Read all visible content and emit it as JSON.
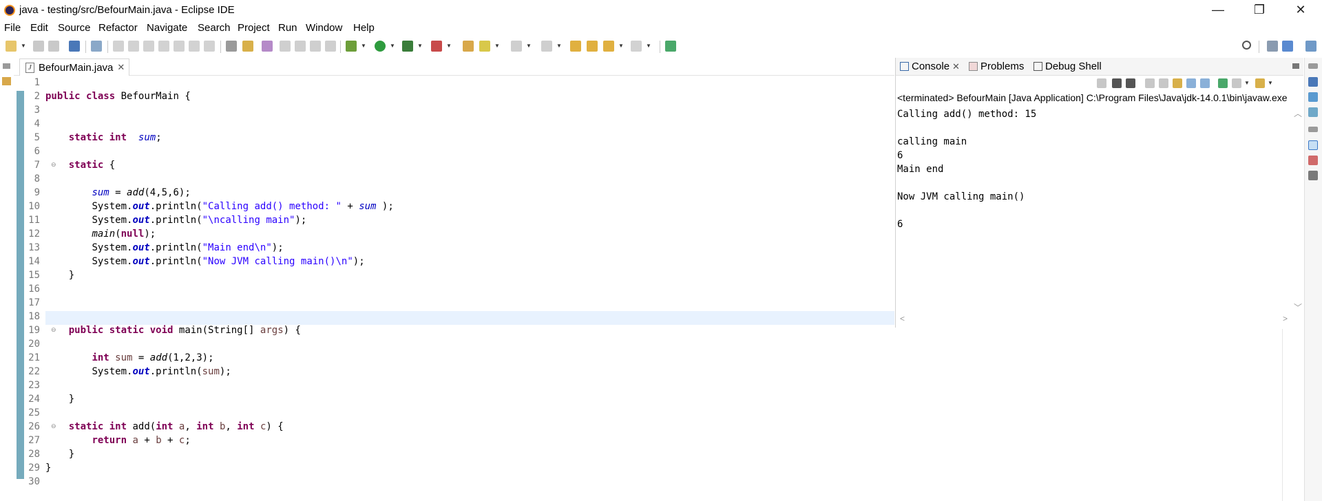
{
  "window": {
    "title": "java - testing/src/BefourMain.java - Eclipse IDE",
    "minimize_glyph": "—",
    "restore_glyph": "❐",
    "close_glyph": "✕"
  },
  "menu": [
    "File",
    "Edit",
    "Source",
    "Refactor",
    "Navigate",
    "Search",
    "Project",
    "Run",
    "Window",
    "Help"
  ],
  "editor": {
    "tab_label": "BefourMain.java",
    "tab_icon_letter": "J",
    "tab_close": "✕",
    "line_numbers": [
      "1",
      "2",
      "3",
      "4",
      "5",
      "6",
      "7",
      "8",
      "9",
      "10",
      "11",
      "12",
      "13",
      "14",
      "15",
      "16",
      "17",
      "18",
      "19",
      "20",
      "21",
      "22",
      "23",
      "24",
      "25",
      "26",
      "27",
      "28",
      "29",
      "30"
    ],
    "fold_marker": "⊖",
    "tokens": {
      "l2_kw1": "public",
      "l2_kw2": "class",
      "l2_rest": " BefourMain {",
      "l5_kw1": "static",
      "l5_kw2": "int",
      "l5_field": "sum",
      "l5_rest": ";",
      "l7_kw": "static",
      "l7_rest": " {",
      "l9_field": "sum",
      "l9_mid": " = ",
      "l9_call": "add",
      "l9_args": "(4,5,6);",
      "sys": "System.",
      "out": "out",
      "println": ".println(",
      "l10_str": "\"Calling add() method: \"",
      "l10_plus": " + ",
      "l10_field": "sum",
      "l10_end": " );",
      "l11_str": "\"\\ncalling main\"",
      "end_paren": ");",
      "l12_call": "main",
      "l12_open": "(",
      "l12_null": "null",
      "l12_end": ");",
      "l13_str": "\"Main end\\n\"",
      "l14_str": "\"Now JVM calling main()\\n\"",
      "close_brace": "}",
      "l19_kw1": "public",
      "l19_kw2": "static",
      "l19_kw3": "void",
      "l19_mid": " main(String[] ",
      "l19_var": "args",
      "l19_end": ") {",
      "l21_kw": "int",
      "l21_var": "sum",
      "l21_mid": " = ",
      "l21_call": "add",
      "l21_args": "(1,2,3);",
      "l22_var": "sum",
      "l26_kw1": "static",
      "l26_kw2": "int",
      "l26_name": " add(",
      "l26_kw3": "int",
      "l26_a": "a",
      "l26_comma": ", ",
      "l26_kw4": "int",
      "l26_b": "b",
      "l26_kw5": "int",
      "l26_c": "c",
      "l26_end": ") {",
      "l27_kw": "return",
      "l27_a": "a",
      "l27_plus": " + ",
      "l27_b": "b",
      "l27_c": "c",
      "l27_end": ";"
    }
  },
  "console": {
    "tabs": [
      "Console",
      "Problems",
      "Debug Shell"
    ],
    "tab_close": "✕",
    "description": "<terminated> BefourMain [Java Application] C:\\Program Files\\Java\\jdk-14.0.1\\bin\\javaw.exe",
    "output": [
      "Calling add() method: 15",
      "",
      "calling main",
      "6",
      "Main end",
      "",
      "Now JVM calling main()",
      "",
      "6"
    ],
    "scroll_up": "︿",
    "scroll_down": "﹀",
    "scroll_left": "<",
    "scroll_right": ">"
  },
  "colors": {
    "keyword": "#7f0055",
    "field": "#0000c0",
    "string": "#2a00ff",
    "local_variable": "#6a3e3e",
    "current_line": "#e8f2fe",
    "ruler": "#76abbd"
  }
}
